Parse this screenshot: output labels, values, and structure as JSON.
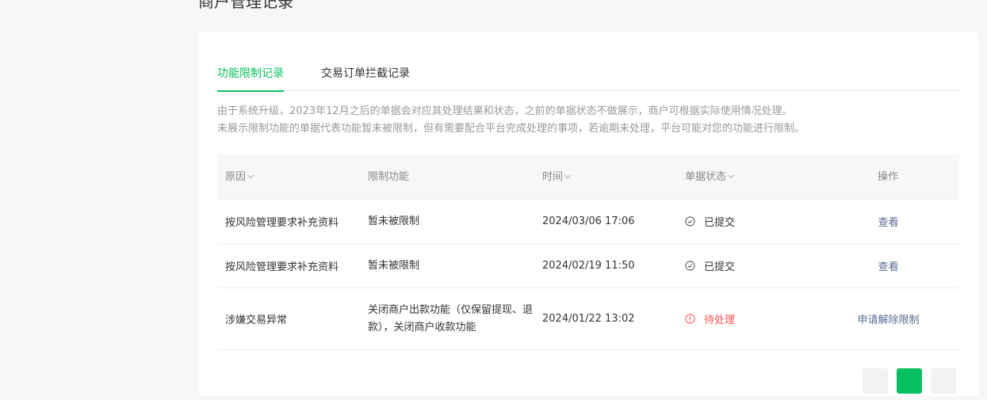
{
  "page": {
    "title": "商户管理记录"
  },
  "tabs": [
    {
      "label": "功能限制记录",
      "active": true
    },
    {
      "label": "交易订单拦截记录",
      "active": false
    }
  ],
  "notice": {
    "line1": "由于系统升级，2023年12月之后的单据会对应其处理结果和状态，之前的单据状态不做展示，商户可根据实际使用情况处理。",
    "line2": "未展示限制功能的单据代表功能暂未被限制，但有需要配合平台完成处理的事项，若逾期未处理，平台可能对您的功能进行限制。"
  },
  "table": {
    "headers": {
      "reason": "原因",
      "restriction": "限制功能",
      "time": "时间",
      "status": "单据状态",
      "action": "操作"
    },
    "rows": [
      {
        "reason": "按风险管理要求补充资料",
        "restriction": "暂未被限制",
        "time": "2024/03/06 17:06",
        "status": "已提交",
        "action": "查看"
      },
      {
        "reason": "按风险管理要求补充资料",
        "restriction": "暂未被限制",
        "time": "2024/02/19 11:50",
        "status": "已提交",
        "action": "查看"
      },
      {
        "reason": "涉嫌交易异常",
        "restriction": "关闭商户出款功能（仅保留提现、退款），关闭商户收款功能",
        "time": "2024/01/22 13:02",
        "status": "待处理",
        "action": "申请解除限制"
      }
    ]
  },
  "colors": {
    "accent": "#07c160",
    "link": "#576b95",
    "pending": "#fa5151"
  },
  "icons": {
    "done": "check-circle-icon",
    "pending": "alert-circle-icon"
  }
}
